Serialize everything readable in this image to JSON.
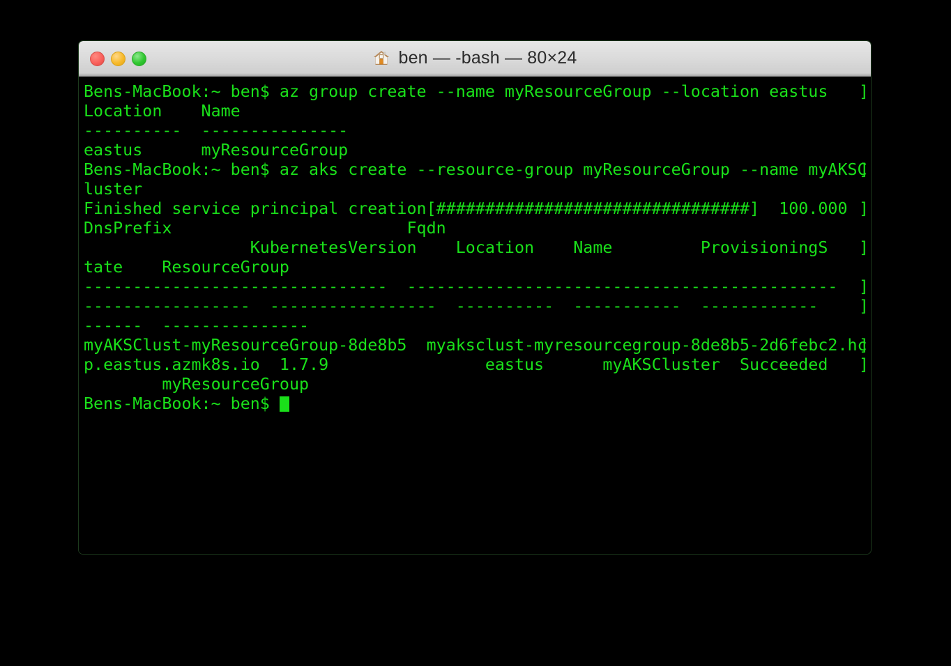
{
  "window": {
    "title": "ben — -bash — 80×24",
    "icon": "home-icon",
    "traffic_lights": {
      "close_label": "close",
      "minimize_label": "minimize",
      "zoom_label": "zoom"
    },
    "colors": {
      "terminal_background": "#000000",
      "terminal_foreground": "#1ae01a",
      "titlebar_background": "#dcdcdc",
      "titlebar_text": "#2b2b2b",
      "close_button": "#f9615c",
      "minimize_button": "#f7ba2c",
      "zoom_button": "#2fc72f",
      "window_border": "#1d3a1d"
    }
  },
  "terminal": {
    "cols": 80,
    "rows": 24,
    "shell": "-bash",
    "user": "ben",
    "host": "Bens-MacBook",
    "prompt": "Bens-MacBook:~ ben$ ",
    "wrap_marker": "]",
    "lines": [
      "Bens-MacBook:~ ben$ az group create --name myResourceGroup --location eastus",
      "Location    Name",
      "----------  ---------------",
      "eastus      myResourceGroup",
      "Bens-MacBook:~ ben$ az aks create --resource-group myResourceGroup --name myAKSC",
      "luster",
      "Finished service principal creation[################################]  100.000",
      "DnsPrefix                        Fqdn",
      "                 KubernetesVersion    Location    Name         ProvisioningS",
      "tate    ResourceGroup",
      "-------------------------------  --------------------------------------------",
      "-----------------  -----------------  ----------  -----------  ------------",
      "------  ---------------",
      "myAKSClust-myResourceGroup-8de8b5  myaksclust-myresourcegroup-8de8b5-2d6febc2.hc",
      "p.eastus.azmk8s.io  1.7.9                eastus      myAKSCluster  Succeeded",
      "        myResourceGroup",
      "Bens-MacBook:~ ben$ "
    ],
    "wrapped_rows": [
      0,
      4,
      6,
      8,
      10,
      11,
      13,
      14
    ],
    "commands": [
      "az group create --name myResourceGroup --location eastus",
      "az aks create --resource-group myResourceGroup --name myAKSCluster"
    ],
    "group_table": {
      "headers": [
        "Location",
        "Name"
      ],
      "rows": [
        [
          "eastus",
          "myResourceGroup"
        ]
      ]
    },
    "progress": {
      "label": "Finished service principal creation",
      "bar": "[################################]",
      "percent": "100.000"
    },
    "aks_table": {
      "headers": [
        "DnsPrefix",
        "Fqdn",
        "KubernetesVersion",
        "Location",
        "Name",
        "ProvisioningState",
        "ResourceGroup"
      ],
      "rows": [
        [
          "myAKSClust-myResourceGroup-8de8b5",
          "myaksclust-myresourcegroup-8de8b5-2d6febc2.hcp.eastus.azmk8s.io",
          "1.7.9",
          "eastus",
          "myAKSCluster",
          "Succeeded",
          "myResourceGroup"
        ]
      ]
    },
    "cursor": {
      "visible": true,
      "style": "block"
    }
  }
}
